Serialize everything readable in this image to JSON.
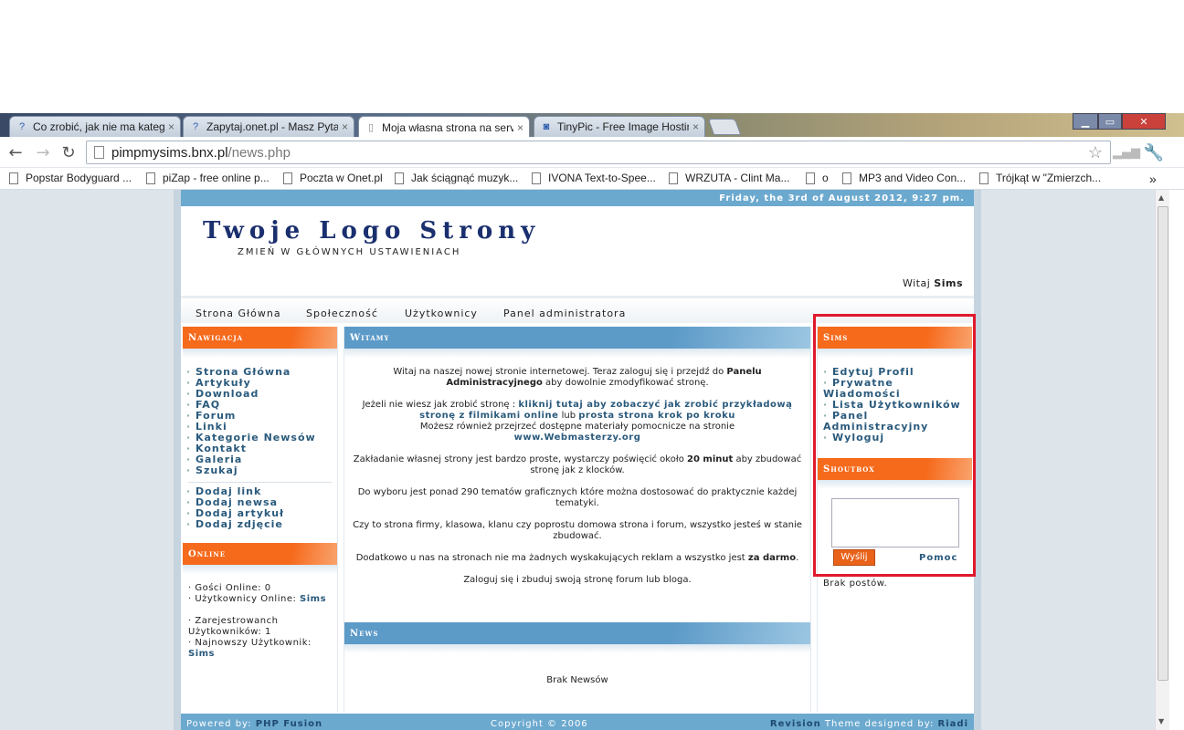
{
  "browser": {
    "tabs": [
      {
        "title": "Co zrobić, jak nie ma kateg"
      },
      {
        "title": "Zapytaj.onet.pl - Masz Pyta"
      },
      {
        "title": "Moja własna strona na serv"
      },
      {
        "title": "TinyPic - Free Image Hostin"
      }
    ],
    "url_host": "pimpmysims.bnx.pl",
    "url_path": "/news.php",
    "bookmarks": [
      "Popstar Bodyguard ...",
      "piZap - free online p...",
      "Poczta w Onet.pl",
      "Jak ściągnąć muzyk...",
      "IVONA Text-to-Spee...",
      "WRZUTA - Clint Ma...",
      "o",
      "MP3 and Video Con...",
      "Trójkąt w \"Zmierzch..."
    ],
    "overflow": "»"
  },
  "site": {
    "date": "Friday, the 3rd of August 2012, 9:27 pm.",
    "logo": "Twoje Logo Strony",
    "slogan": "ZMIEŃ W GŁÓWNYCH USTAWIENIACH",
    "welcome_prefix": "Witaj",
    "welcome_user": "Sims",
    "menu": [
      "Strona Główna",
      "Społeczność",
      "Użytkownicy",
      "Panel administratora"
    ],
    "nav": {
      "title": "Nawigacja",
      "links": [
        "Strona Główna",
        "Artykuły",
        "Download",
        "FAQ",
        "Forum",
        "Linki",
        "Kategorie Newsów",
        "Kontakt",
        "Galeria",
        "Szukaj"
      ],
      "submit_links": [
        "Dodaj link",
        "Dodaj newsa",
        "Dodaj artykuł",
        "Dodaj zdjęcie"
      ]
    },
    "online": {
      "title": "Online",
      "guests": "Gości Online: 0",
      "users_label": "Użytkownicy Online:",
      "users_value": "Sims",
      "registered_1": "Zarejestrowanch",
      "registered_2": "Użytkowników: 1",
      "newest_label": "Najnowszy Użytkownik:",
      "newest_value": "Sims"
    },
    "welcome_panel": {
      "title": "Witamy",
      "p1_a": "Witaj na naszej nowej stronie internetowej. Teraz zaloguj się i przejdź do",
      "p1_b": "Panelu Administracyjnego",
      "p1_c": "aby dowolnie zmodyfikować stronę.",
      "p2_a": "Jeżeli nie wiesz jak zrobić stronę :",
      "p2_link1": "kliknij tutaj aby zobaczyć jak zrobić przykładową stronę z filmikami online",
      "p2_b": "lub",
      "p2_link2": "prosta strona krok po kroku",
      "p2_c": "Możesz również przejrzeć dostępne materiały pomocnicze na stronie",
      "p2_link3": "www.Webmasterzy.org",
      "p3_a": "Zakładanie własnej strony jest bardzo proste, wystarczy poświęcić około",
      "p3_b": "20 minut",
      "p3_c": "aby zbudować stronę jak z klocków.",
      "p4": "Do wyboru jest ponad 290 tematów graficznych które można dostosować do praktycznie każdej tematyki.",
      "p5": "Czy to strona firmy, klasowa, klanu czy poprostu domowa strona i forum, wszystko jesteś w stanie zbudować.",
      "p6_a": "Dodatkowo u nas na stronach nie ma żadnych wyskakujących reklam a wszystko jest",
      "p6_b": "za darmo",
      "p6_c": ".",
      "p7": "Zaloguj się i zbuduj swoją stronę forum lub bloga."
    },
    "news": {
      "title": "News",
      "empty": "Brak Newsów"
    },
    "user_panel": {
      "title": "Sims",
      "links": [
        "Edytuj Profil",
        "Prywatne Wiadomości",
        "Lista Użytkowników",
        "Panel Administracyjny",
        "Wyloguj"
      ]
    },
    "shoutbox": {
      "title": "Shoutbox",
      "send": "Wyślij",
      "help": "Pomoc",
      "empty": "Brak postów."
    },
    "footer": {
      "powered_label": "Powered by:",
      "powered_value": "PHP Fusion",
      "copyright": "Copyright © 2006",
      "revision": "Revision",
      "theme_label": "Theme designed by:",
      "theme_value": "Riadi"
    }
  },
  "colors": {
    "accent_orange": "#f66a1c",
    "accent_blue": "#5c9ac8",
    "highlight_box": "#e0192c"
  }
}
